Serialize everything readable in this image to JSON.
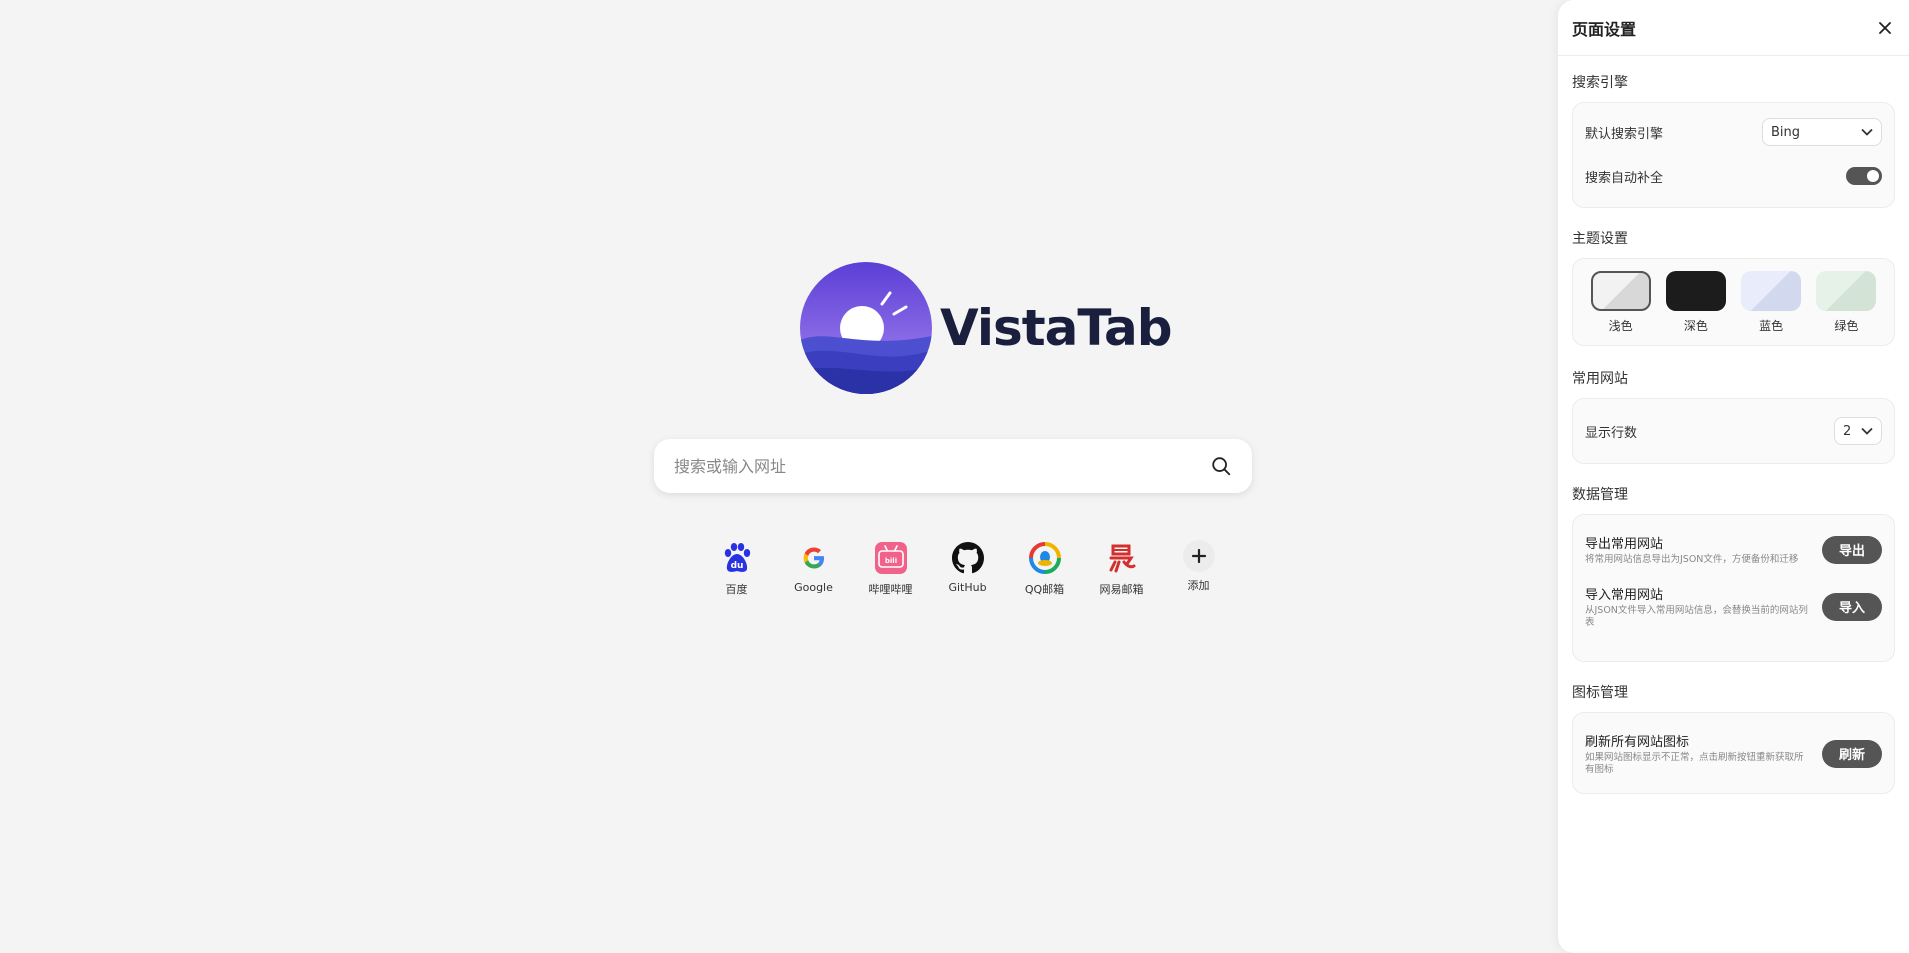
{
  "logo": {
    "text": "VistaTab"
  },
  "search": {
    "placeholder": "搜索或输入网址"
  },
  "shortcuts": [
    {
      "label": "百度",
      "icon": "baidu-icon"
    },
    {
      "label": "Google",
      "icon": "google-icon"
    },
    {
      "label": "哔哩哔哩",
      "icon": "bilibili-icon"
    },
    {
      "label": "GitHub",
      "icon": "github-icon"
    },
    {
      "label": "QQ邮箱",
      "icon": "qqmail-icon"
    },
    {
      "label": "网易邮箱",
      "icon": "netease-mail-icon"
    },
    {
      "label": "添加",
      "icon": "plus-icon"
    }
  ],
  "panel": {
    "title": "页面设置",
    "search_engine": {
      "section_title": "搜索引擎",
      "default_label": "默认搜索引擎",
      "default_value": "Bing",
      "autocomplete_label": "搜索自动补全",
      "autocomplete_on": true
    },
    "theme": {
      "section_title": "主题设置",
      "options": [
        {
          "label": "浅色",
          "color": "#e6e6e6",
          "selected": true
        },
        {
          "label": "深色",
          "color": "#1c1c1c",
          "selected": false
        },
        {
          "label": "蓝色",
          "color": "#dde3f5",
          "selected": false
        },
        {
          "label": "绿色",
          "color": "#dbe9de",
          "selected": false
        }
      ]
    },
    "sites": {
      "section_title": "常用网站",
      "rows_label": "显示行数",
      "rows_value": "2"
    },
    "data": {
      "section_title": "数据管理",
      "export_title": "导出常用网站",
      "export_desc": "将常用网站信息导出为JSON文件，方便备份和迁移",
      "export_button": "导出",
      "import_title": "导入常用网站",
      "import_desc": "从JSON文件导入常用网站信息，会替换当前的网站列表",
      "import_button": "导入"
    },
    "icons": {
      "section_title": "图标管理",
      "refresh_title": "刷新所有网站图标",
      "refresh_desc": "如果网站图标显示不正常，点击刷新按钮重新获取所有图标",
      "refresh_button": "刷新"
    }
  }
}
